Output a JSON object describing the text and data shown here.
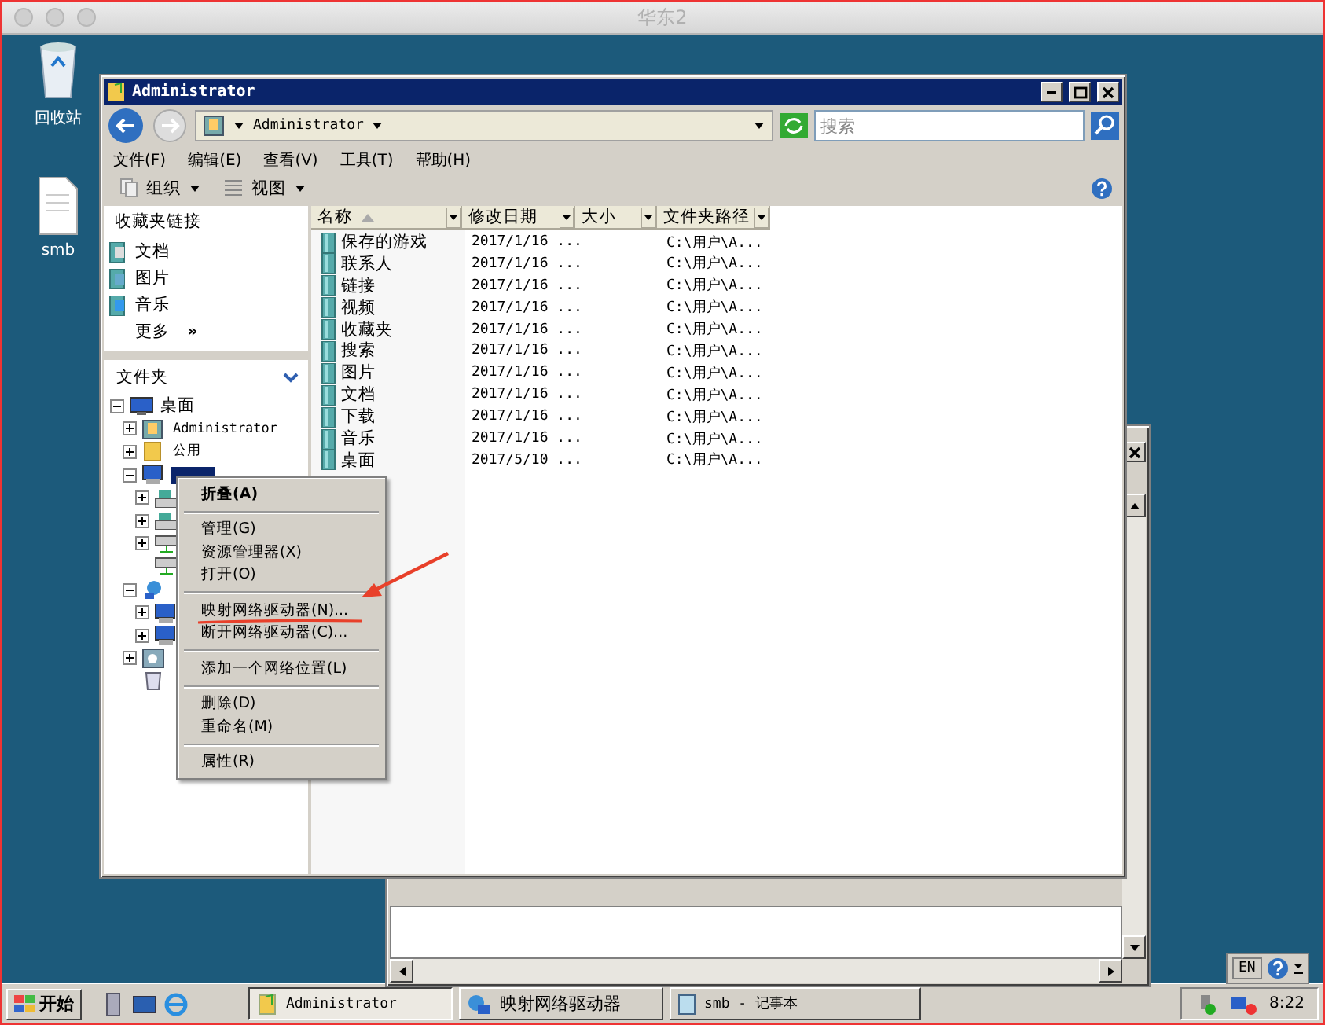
{
  "frame": {
    "title": "华东2"
  },
  "desktop_icons": [
    {
      "label": "回收站",
      "kind": "bin"
    },
    {
      "label": "smb",
      "kind": "file"
    }
  ],
  "explorer": {
    "title": "Administrator",
    "address": "Administrator",
    "search": {
      "placeholder": "搜索"
    },
    "menu": [
      "文件(F)",
      "编辑(E)",
      "查看(V)",
      "工具(T)",
      "帮助(H)"
    ],
    "toolbar": [
      "组织",
      "视图"
    ],
    "favorites": {
      "title": "收藏夹链接",
      "items": [
        {
          "label": "文档",
          "kind": "doc"
        },
        {
          "label": "图片",
          "kind": "pic"
        },
        {
          "label": "音乐",
          "kind": "music"
        }
      ],
      "more": "更多",
      "more_glyph": "»"
    },
    "folders": {
      "title": "文件夹",
      "tree": [
        {
          "label": "桌面",
          "kind": "desktop",
          "expanded": true,
          "selected": false,
          "children": [
            {
              "label": "Administrator",
              "kind": "user",
              "expanded": false,
              "selected": false
            },
            {
              "label": "公用",
              "kind": "folder",
              "expanded": false,
              "selected": false
            },
            {
              "kind": "computer",
              "expanded": true,
              "selected": true,
              "children": [
                {
                  "kind": "drive",
                  "expanded": false,
                  "selected": false
                },
                {
                  "kind": "drive",
                  "expanded": false,
                  "selected": false
                },
                {
                  "kind": "netdrive",
                  "expanded": false,
                  "selected": false
                },
                {
                  "kind": "netdrive",
                  "selected": false
                }
              ]
            },
            {
              "kind": "network",
              "expanded": true,
              "selected": false,
              "children": [
                {
                  "kind": "computer",
                  "expanded": false,
                  "selected": false
                },
                {
                  "kind": "computer",
                  "expanded": false,
                  "selected": false
                }
              ]
            },
            {
              "kind": "panel",
              "expanded": false,
              "selected": false
            },
            {
              "kind": "bin",
              "selected": false
            }
          ]
        }
      ]
    },
    "columns": [
      {
        "label": "名称",
        "sorted": true
      },
      {
        "label": "修改日期",
        "sorted": false
      },
      {
        "label": "大小",
        "sorted": false
      },
      {
        "label": "文件夹路径",
        "sorted": false
      }
    ],
    "rows": [
      {
        "name": "保存的游戏",
        "date": "2017/1/16 ...",
        "path": "C:\\用户\\A..."
      },
      {
        "name": "联系人",
        "date": "2017/1/16 ...",
        "path": "C:\\用户\\A..."
      },
      {
        "name": "链接",
        "date": "2017/1/16 ...",
        "path": "C:\\用户\\A..."
      },
      {
        "name": "视频",
        "date": "2017/1/16 ...",
        "path": "C:\\用户\\A..."
      },
      {
        "name": "收藏夹",
        "date": "2017/1/16 ...",
        "path": "C:\\用户\\A..."
      },
      {
        "name": "搜索",
        "date": "2017/1/16 ...",
        "path": "C:\\用户\\A..."
      },
      {
        "name": "图片",
        "date": "2017/1/16 ...",
        "path": "C:\\用户\\A..."
      },
      {
        "name": "文档",
        "date": "2017/1/16 ...",
        "path": "C:\\用户\\A..."
      },
      {
        "name": "下载",
        "date": "2017/1/16 ...",
        "path": "C:\\用户\\A..."
      },
      {
        "name": "音乐",
        "date": "2017/1/16 ...",
        "path": "C:\\用户\\A..."
      },
      {
        "name": "桌面",
        "date": "2017/5/10 ...",
        "path": "C:\\用户\\A..."
      }
    ]
  },
  "context_menu": [
    [
      {
        "label": "折叠(A)",
        "default": true
      }
    ],
    [
      {
        "label": "管理(G)",
        "default": false
      },
      {
        "label": "资源管理器(X)",
        "default": false
      },
      {
        "label": "打开(O)",
        "default": false
      }
    ],
    [
      {
        "label": "映射网络驱动器(N)...",
        "default": false
      },
      {
        "label": "断开网络驱动器(C)...",
        "default": false
      }
    ],
    [
      {
        "label": "添加一个网络位置(L)",
        "default": false
      }
    ],
    [
      {
        "label": "删除(D)",
        "default": false
      },
      {
        "label": "重命名(M)",
        "default": false
      }
    ],
    [
      {
        "label": "属性(R)",
        "default": false
      }
    ]
  ],
  "language_bar": {
    "language": "EN"
  },
  "taskbar": {
    "start": "开始",
    "tasks": [
      {
        "label": "Administrator",
        "kind": "explorer",
        "selected": true
      },
      {
        "label": "映射网络驱动器",
        "kind": "network",
        "selected": false
      },
      {
        "label": "smb - 记事本",
        "kind": "notepad",
        "selected": false
      }
    ],
    "clock": "8:22"
  }
}
